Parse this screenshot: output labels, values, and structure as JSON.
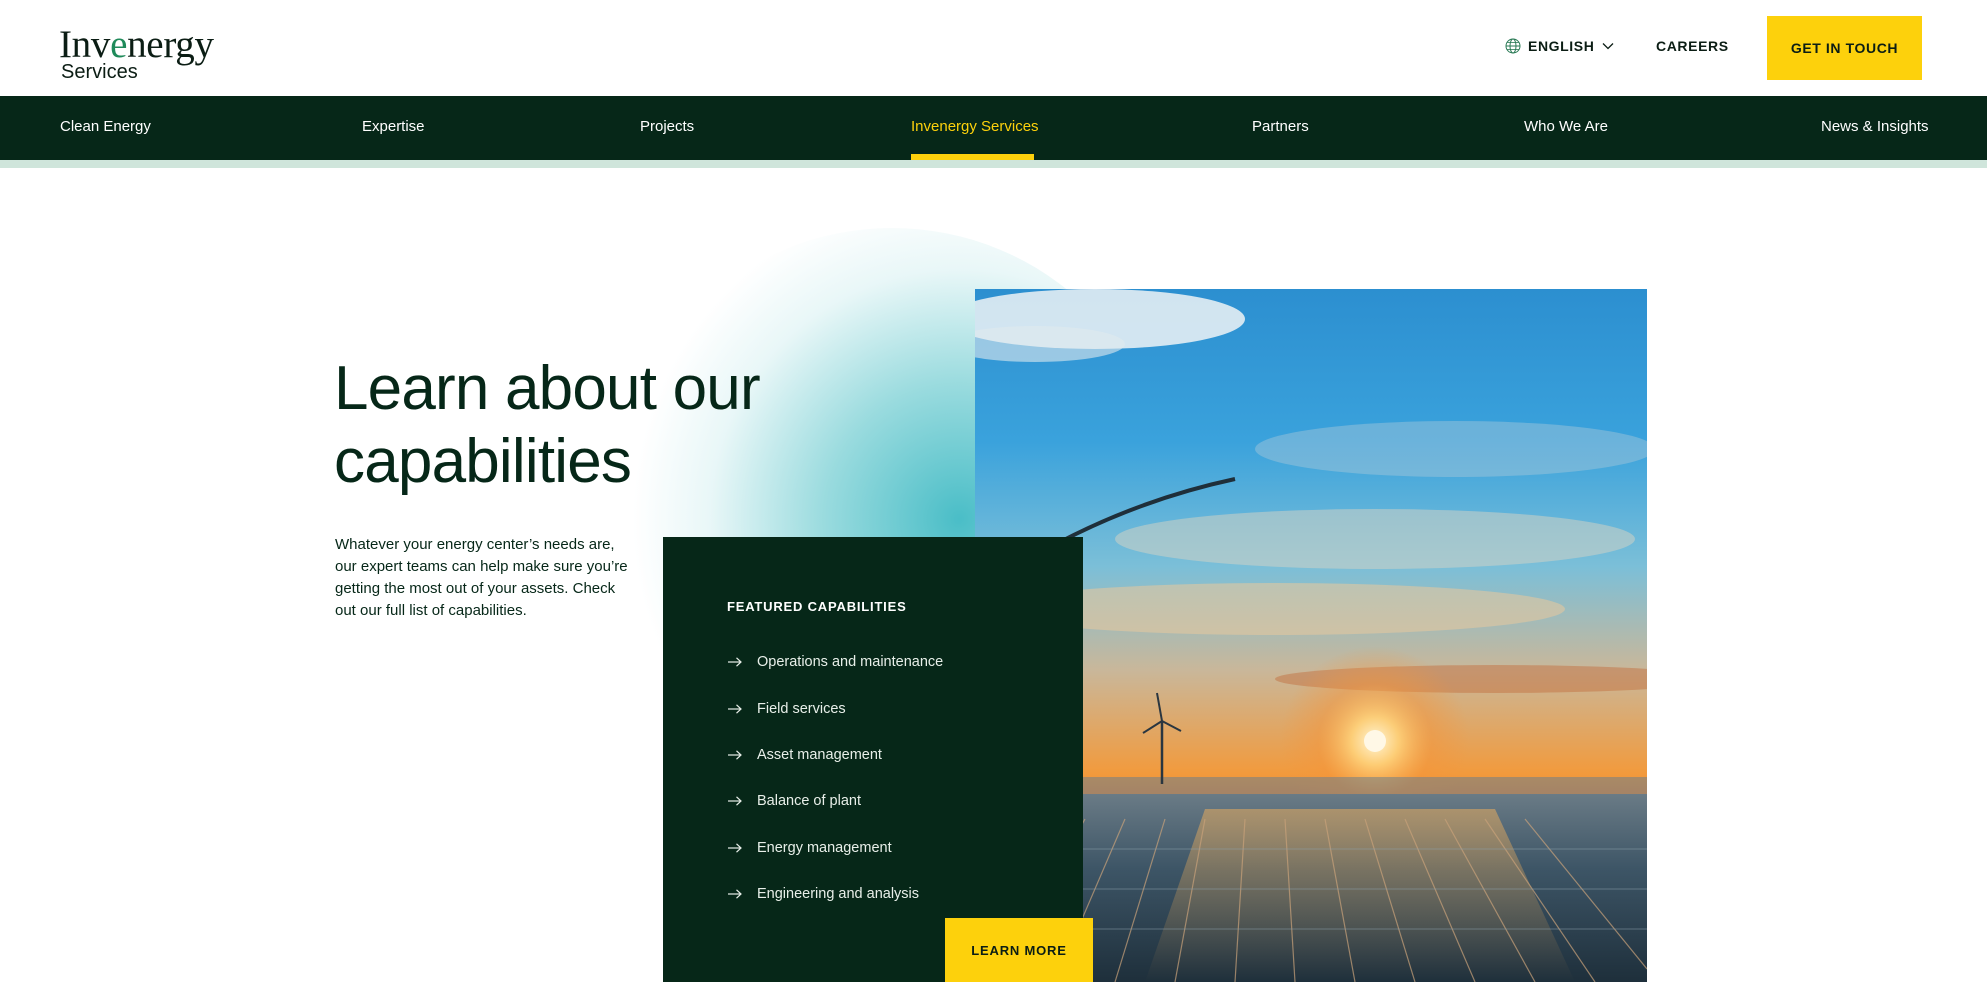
{
  "header": {
    "logo_main_prefix": "Inv",
    "logo_main_accent": "e",
    "logo_main_suffix": "nergy",
    "logo_sub": "Services",
    "language_label": "ENGLISH",
    "careers_label": "CAREERS",
    "cta_label": "GET IN TOUCH"
  },
  "nav": {
    "items": [
      {
        "label": "Clean Energy"
      },
      {
        "label": "Expertise"
      },
      {
        "label": "Projects"
      },
      {
        "label": "Invenergy Services"
      },
      {
        "label": "Partners"
      },
      {
        "label": "Who We Are"
      },
      {
        "label": "News & Insights"
      }
    ],
    "active": "Invenergy Services"
  },
  "hero": {
    "title": "Learn about our capabilities",
    "description": "Whatever your energy center’s needs are, our expert teams can help make sure you’re getting the most out of your assets. Check out our full list of capabilities."
  },
  "capabilities": {
    "heading": "FEATURED CAPABILITIES",
    "items": [
      {
        "label": "Operations and maintenance"
      },
      {
        "label": "Field services"
      },
      {
        "label": "Asset management"
      },
      {
        "label": "Balance of plant"
      },
      {
        "label": "Energy management"
      },
      {
        "label": "Engineering and analysis"
      }
    ],
    "cta_label": "LEARN MORE"
  },
  "colors": {
    "brand_dark": "#062718",
    "accent_yellow": "#fdd10c",
    "logo_green": "#1f8a5a",
    "nav_strip": "#cfe5db",
    "glow_teal": "#40bac4"
  },
  "icons": {
    "language": "globe-icon",
    "language_dropdown": "chevron-down-icon",
    "capability_bullet": "arrow-right-icon"
  }
}
